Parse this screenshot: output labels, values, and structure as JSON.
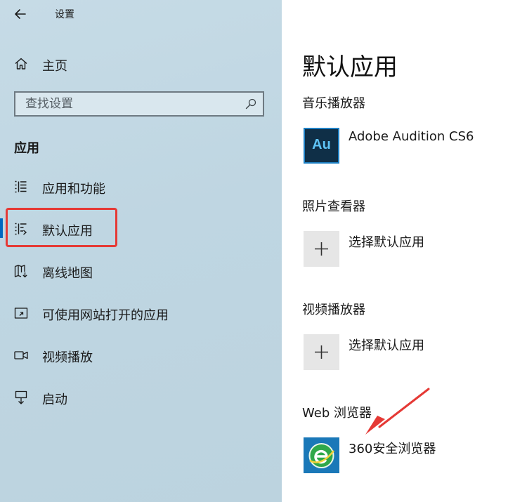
{
  "window": {
    "title": "设置"
  },
  "sidebar": {
    "home_label": "主页",
    "search": {
      "placeholder": "查找设置"
    },
    "section_title": "应用",
    "items": [
      {
        "label": "应用和功能",
        "icon": "apps-features-icon"
      },
      {
        "label": "默认应用",
        "icon": "default-apps-icon",
        "selected": true
      },
      {
        "label": "离线地图",
        "icon": "offline-maps-icon"
      },
      {
        "label": "可使用网站打开的应用",
        "icon": "apps-for-websites-icon"
      },
      {
        "label": "视频播放",
        "icon": "video-playback-icon"
      },
      {
        "label": "启动",
        "icon": "startup-icon"
      }
    ]
  },
  "main": {
    "title": "默认应用",
    "categories": [
      {
        "label": "音乐播放器",
        "app": "Adobe Audition CS6",
        "icon": "adobe-audition-icon",
        "tile_text": "Au"
      },
      {
        "label": "照片查看器",
        "app": "选择默认应用",
        "icon": "plus-icon"
      },
      {
        "label": "视频播放器",
        "app": "选择默认应用",
        "icon": "plus-icon"
      },
      {
        "label": "Web 浏览器",
        "app": "360安全浏览器",
        "icon": "360-browser-icon"
      }
    ]
  },
  "colors": {
    "accent": "#0067c0",
    "annotation": "#e53935",
    "sidebar_bg": "#c2d8e4"
  }
}
